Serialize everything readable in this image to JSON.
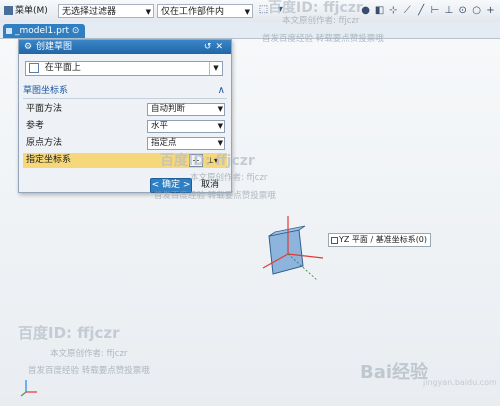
{
  "toolbar": {
    "menu_label": "菜单(M)",
    "filter_value": "无选择过滤器",
    "scope_value": "仅在工作部件内"
  },
  "tabs": [
    {
      "label": "_model1.prt ⊙"
    }
  ],
  "dialog": {
    "title": "创建草图",
    "type_value": "在平面上",
    "section_label": "草图坐标系",
    "rows": [
      {
        "label": "平面方法",
        "value": "自动判断"
      },
      {
        "label": "参考",
        "value": "水平"
      },
      {
        "label": "原点方法",
        "value": "指定点"
      },
      {
        "label": "指定坐标系"
      }
    ],
    "ok_label": "< 确定 >",
    "cancel_label": "取消"
  },
  "viewport": {
    "plane_label": "YZ 平面 / 基准坐标系(0)",
    "axis_color": "#e53935",
    "plane_color": "#6b9fd4"
  },
  "watermark": {
    "brand": "百度ID: ffjczr",
    "author": "本文原创作者: ffjczr",
    "note": "首发百度经验  转载要点赞投票哦",
    "logo": "Bai经验",
    "site": "jingyan.baidu.com"
  },
  "colors": {
    "title_bar": "#2f7fc2",
    "highlight": "#f6d77a",
    "section_text": "#1a55a3"
  }
}
